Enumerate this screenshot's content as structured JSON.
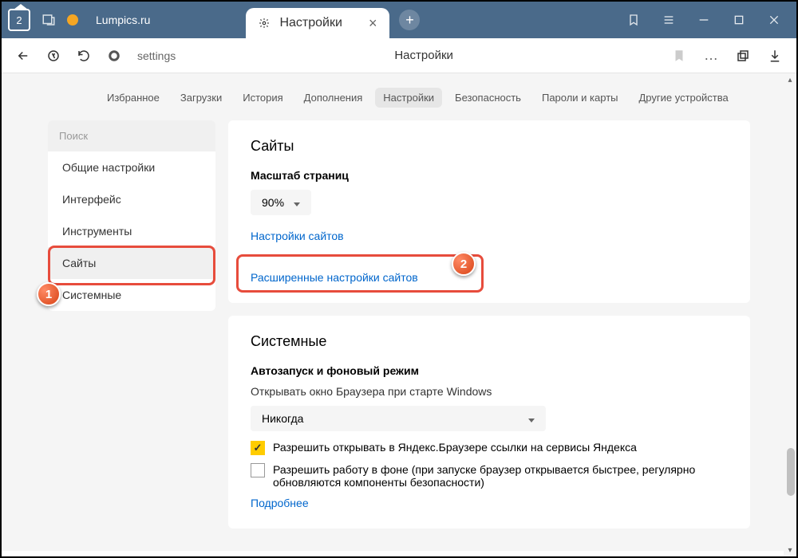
{
  "titlebar": {
    "home_badge": "2",
    "inactive_tab": "Lumpics.ru",
    "active_tab": "Настройки"
  },
  "toolbar": {
    "url": "settings",
    "title": "Настройки"
  },
  "topnav": [
    "Избранное",
    "Загрузки",
    "История",
    "Дополнения",
    "Настройки",
    "Безопасность",
    "Пароли и карты",
    "Другие устройства"
  ],
  "topnav_active_index": 4,
  "sidebar": {
    "search_placeholder": "Поиск",
    "items": [
      "Общие настройки",
      "Интерфейс",
      "Инструменты",
      "Сайты",
      "Системные"
    ],
    "active_index": 3
  },
  "sites_panel": {
    "title": "Сайты",
    "zoom_label": "Масштаб страниц",
    "zoom_value": "90%",
    "site_settings_link": "Настройки сайтов",
    "advanced_link": "Расширенные настройки сайтов"
  },
  "system_panel": {
    "title": "Системные",
    "autostart_heading": "Автозапуск и фоновый режим",
    "autostart_label": "Открывать окно Браузера при старте Windows",
    "autostart_value": "Никогда",
    "checkbox1": "Разрешить открывать в Яндекс.Браузере ссылки на сервисы Яндекса",
    "checkbox2": "Разрешить работу в фоне (при запуске браузер открывается быстрее, регулярно обновляются компоненты безопасности)",
    "more_link": "Подробнее"
  },
  "annotations": {
    "badge1": "1",
    "badge2": "2"
  }
}
